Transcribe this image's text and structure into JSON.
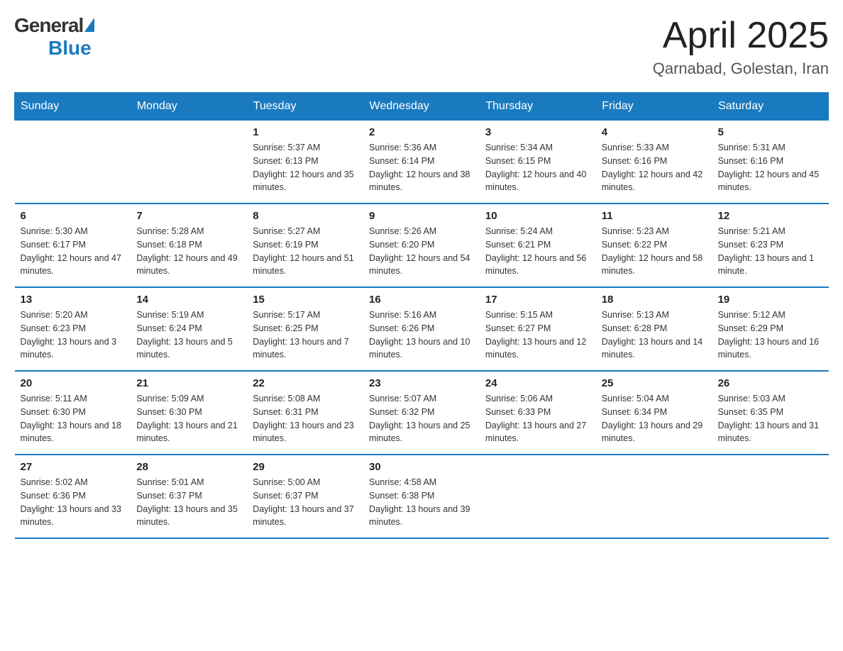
{
  "logo": {
    "general": "General",
    "blue": "Blue"
  },
  "title": "April 2025",
  "subtitle": "Qarnabad, Golestan, Iran",
  "headers": [
    "Sunday",
    "Monday",
    "Tuesday",
    "Wednesday",
    "Thursday",
    "Friday",
    "Saturday"
  ],
  "weeks": [
    [
      {
        "day": "",
        "sunrise": "",
        "sunset": "",
        "daylight": ""
      },
      {
        "day": "",
        "sunrise": "",
        "sunset": "",
        "daylight": ""
      },
      {
        "day": "1",
        "sunrise": "Sunrise: 5:37 AM",
        "sunset": "Sunset: 6:13 PM",
        "daylight": "Daylight: 12 hours and 35 minutes."
      },
      {
        "day": "2",
        "sunrise": "Sunrise: 5:36 AM",
        "sunset": "Sunset: 6:14 PM",
        "daylight": "Daylight: 12 hours and 38 minutes."
      },
      {
        "day": "3",
        "sunrise": "Sunrise: 5:34 AM",
        "sunset": "Sunset: 6:15 PM",
        "daylight": "Daylight: 12 hours and 40 minutes."
      },
      {
        "day": "4",
        "sunrise": "Sunrise: 5:33 AM",
        "sunset": "Sunset: 6:16 PM",
        "daylight": "Daylight: 12 hours and 42 minutes."
      },
      {
        "day": "5",
        "sunrise": "Sunrise: 5:31 AM",
        "sunset": "Sunset: 6:16 PM",
        "daylight": "Daylight: 12 hours and 45 minutes."
      }
    ],
    [
      {
        "day": "6",
        "sunrise": "Sunrise: 5:30 AM",
        "sunset": "Sunset: 6:17 PM",
        "daylight": "Daylight: 12 hours and 47 minutes."
      },
      {
        "day": "7",
        "sunrise": "Sunrise: 5:28 AM",
        "sunset": "Sunset: 6:18 PM",
        "daylight": "Daylight: 12 hours and 49 minutes."
      },
      {
        "day": "8",
        "sunrise": "Sunrise: 5:27 AM",
        "sunset": "Sunset: 6:19 PM",
        "daylight": "Daylight: 12 hours and 51 minutes."
      },
      {
        "day": "9",
        "sunrise": "Sunrise: 5:26 AM",
        "sunset": "Sunset: 6:20 PM",
        "daylight": "Daylight: 12 hours and 54 minutes."
      },
      {
        "day": "10",
        "sunrise": "Sunrise: 5:24 AM",
        "sunset": "Sunset: 6:21 PM",
        "daylight": "Daylight: 12 hours and 56 minutes."
      },
      {
        "day": "11",
        "sunrise": "Sunrise: 5:23 AM",
        "sunset": "Sunset: 6:22 PM",
        "daylight": "Daylight: 12 hours and 58 minutes."
      },
      {
        "day": "12",
        "sunrise": "Sunrise: 5:21 AM",
        "sunset": "Sunset: 6:23 PM",
        "daylight": "Daylight: 13 hours and 1 minute."
      }
    ],
    [
      {
        "day": "13",
        "sunrise": "Sunrise: 5:20 AM",
        "sunset": "Sunset: 6:23 PM",
        "daylight": "Daylight: 13 hours and 3 minutes."
      },
      {
        "day": "14",
        "sunrise": "Sunrise: 5:19 AM",
        "sunset": "Sunset: 6:24 PM",
        "daylight": "Daylight: 13 hours and 5 minutes."
      },
      {
        "day": "15",
        "sunrise": "Sunrise: 5:17 AM",
        "sunset": "Sunset: 6:25 PM",
        "daylight": "Daylight: 13 hours and 7 minutes."
      },
      {
        "day": "16",
        "sunrise": "Sunrise: 5:16 AM",
        "sunset": "Sunset: 6:26 PM",
        "daylight": "Daylight: 13 hours and 10 minutes."
      },
      {
        "day": "17",
        "sunrise": "Sunrise: 5:15 AM",
        "sunset": "Sunset: 6:27 PM",
        "daylight": "Daylight: 13 hours and 12 minutes."
      },
      {
        "day": "18",
        "sunrise": "Sunrise: 5:13 AM",
        "sunset": "Sunset: 6:28 PM",
        "daylight": "Daylight: 13 hours and 14 minutes."
      },
      {
        "day": "19",
        "sunrise": "Sunrise: 5:12 AM",
        "sunset": "Sunset: 6:29 PM",
        "daylight": "Daylight: 13 hours and 16 minutes."
      }
    ],
    [
      {
        "day": "20",
        "sunrise": "Sunrise: 5:11 AM",
        "sunset": "Sunset: 6:30 PM",
        "daylight": "Daylight: 13 hours and 18 minutes."
      },
      {
        "day": "21",
        "sunrise": "Sunrise: 5:09 AM",
        "sunset": "Sunset: 6:30 PM",
        "daylight": "Daylight: 13 hours and 21 minutes."
      },
      {
        "day": "22",
        "sunrise": "Sunrise: 5:08 AM",
        "sunset": "Sunset: 6:31 PM",
        "daylight": "Daylight: 13 hours and 23 minutes."
      },
      {
        "day": "23",
        "sunrise": "Sunrise: 5:07 AM",
        "sunset": "Sunset: 6:32 PM",
        "daylight": "Daylight: 13 hours and 25 minutes."
      },
      {
        "day": "24",
        "sunrise": "Sunrise: 5:06 AM",
        "sunset": "Sunset: 6:33 PM",
        "daylight": "Daylight: 13 hours and 27 minutes."
      },
      {
        "day": "25",
        "sunrise": "Sunrise: 5:04 AM",
        "sunset": "Sunset: 6:34 PM",
        "daylight": "Daylight: 13 hours and 29 minutes."
      },
      {
        "day": "26",
        "sunrise": "Sunrise: 5:03 AM",
        "sunset": "Sunset: 6:35 PM",
        "daylight": "Daylight: 13 hours and 31 minutes."
      }
    ],
    [
      {
        "day": "27",
        "sunrise": "Sunrise: 5:02 AM",
        "sunset": "Sunset: 6:36 PM",
        "daylight": "Daylight: 13 hours and 33 minutes."
      },
      {
        "day": "28",
        "sunrise": "Sunrise: 5:01 AM",
        "sunset": "Sunset: 6:37 PM",
        "daylight": "Daylight: 13 hours and 35 minutes."
      },
      {
        "day": "29",
        "sunrise": "Sunrise: 5:00 AM",
        "sunset": "Sunset: 6:37 PM",
        "daylight": "Daylight: 13 hours and 37 minutes."
      },
      {
        "day": "30",
        "sunrise": "Sunrise: 4:58 AM",
        "sunset": "Sunset: 6:38 PM",
        "daylight": "Daylight: 13 hours and 39 minutes."
      },
      {
        "day": "",
        "sunrise": "",
        "sunset": "",
        "daylight": ""
      },
      {
        "day": "",
        "sunrise": "",
        "sunset": "",
        "daylight": ""
      },
      {
        "day": "",
        "sunrise": "",
        "sunset": "",
        "daylight": ""
      }
    ]
  ]
}
